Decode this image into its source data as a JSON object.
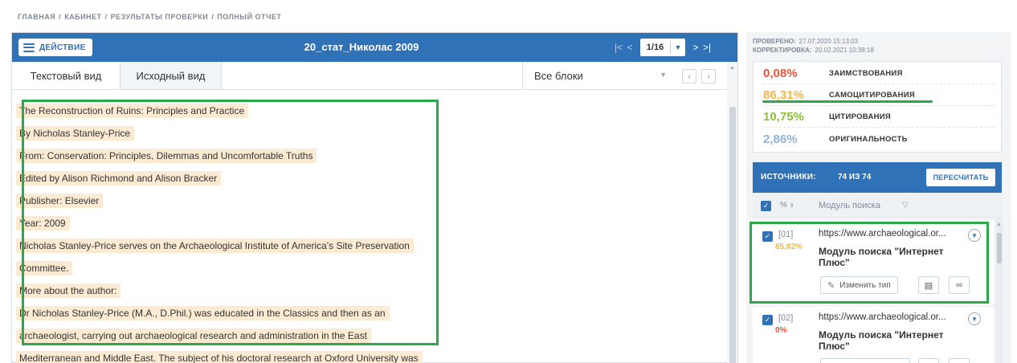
{
  "breadcrumb": {
    "home": "ГЛАВНАЯ",
    "cabinet": "КАБИНЕТ",
    "results": "РЕЗУЛЬТАТЫ ПРОВЕРКИ",
    "report": "ПОЛНЫЙ ОТЧЕТ",
    "separator": "/"
  },
  "toolbar": {
    "action_label": "ДЕЙСТВИЕ",
    "document_title": "20_стат_Николас 2009",
    "page_value": "1/16",
    "first_icon": "|<",
    "prev_icon": "<",
    "next_icon": ">",
    "last_icon": ">|",
    "dropdown_icon": "chevron-down-icon"
  },
  "tabs": {
    "text_view": "Текстовый вид",
    "source_view": "Исходный вид",
    "blocks_select": "Все блоки"
  },
  "document_lines": [
    "The Reconstruction of Ruins: Principles and Practice",
    "By Nicholas Stanley-Price",
    "From: Conservation: Principles, Dilemmas and Uncomfortable Truths",
    "Edited by Alison Richmond and Alison Bracker",
    "Publisher: Elsevier",
    "Year: 2009",
    "Nicholas Stanley-Price serves on the Archaeological Institute of America's Site Preservation",
    "Committee.",
    "More about the author:",
    "Dr Nicholas Stanley-Price (M.A., D.Phil.) was educated in the Classics and then as an",
    "archaeologist, carrying out archaeological research and administration in the East",
    "Mediterranean and Middle East. The subject of his doctoral research at Oxford University was"
  ],
  "meta": {
    "checked_label": "ПРОВЕРЕНО:",
    "checked_value": "27.07.2020 15:13:03",
    "corrected_label": "КОРРЕКТИРОВКА:",
    "corrected_value": "20.02.2021 10:38:18"
  },
  "stats": [
    {
      "value": "0,08%",
      "label": "ЗАИМСТВОВАНИЯ",
      "color": "#e8553b"
    },
    {
      "value": "86,31%",
      "label": "САМОЦИТИРОВАНИЯ",
      "color": "#f2b64b"
    },
    {
      "value": "10,75%",
      "label": "ЦИТИРОВАНИЯ",
      "color": "#8bbf3a"
    },
    {
      "value": "2,86%",
      "label": "ОРИГИНАЛЬНОСТЬ",
      "color": "#8fb3d6"
    }
  ],
  "sources": {
    "title": "ИСТОЧНИКИ:",
    "count": "74 ИЗ 74",
    "recalc_label": "ПЕРЕСЧИТАТЬ",
    "sort_label": "%",
    "module_label": "Модуль поиска",
    "items": [
      {
        "index": "[01]",
        "percent": "85,82%",
        "percent_color": "#f2b64b",
        "url": "https://www.archaeological.or...",
        "module": "Модуль поиска \"Интернет Плюс\"",
        "change_type_label": "Изменить тип"
      },
      {
        "index": "[02]",
        "percent": "0%",
        "percent_color": "#e8553b",
        "url": "https://www.archaeological.or...",
        "module": "Модуль поиска \"Интернет Плюс\""
      }
    ]
  },
  "colors": {
    "accent": "#2f72b8",
    "highlight": "#fcebd2",
    "annotation_green": "#2ba84a"
  }
}
